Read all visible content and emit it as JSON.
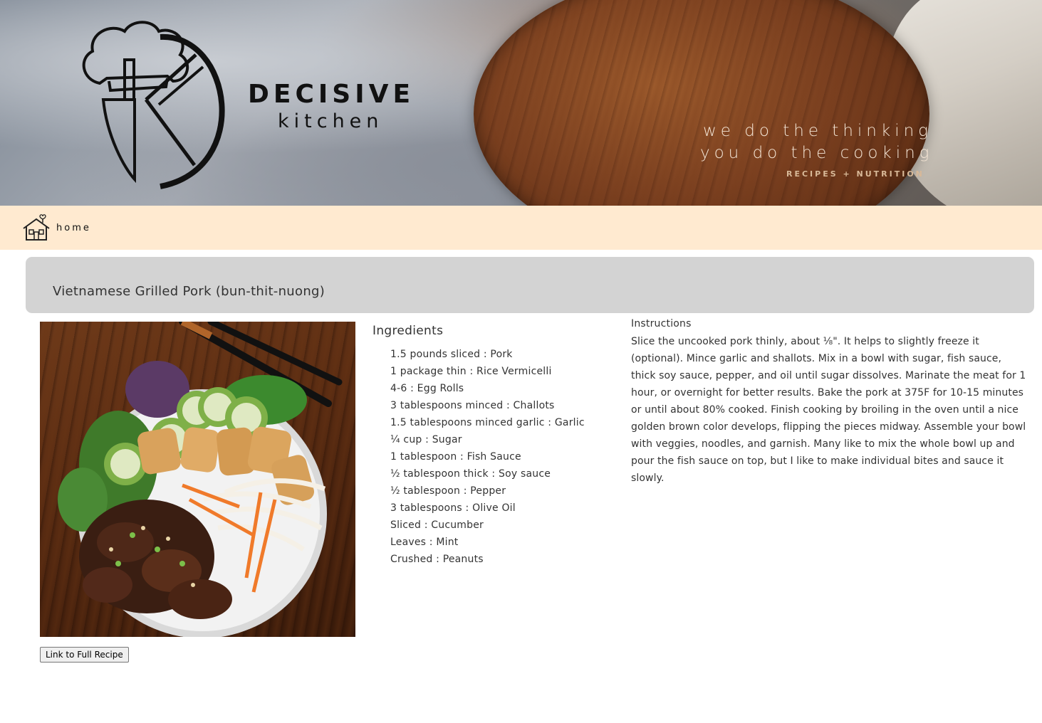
{
  "header": {
    "brand_line1": "DECISIVE",
    "brand_line2": "kitchen",
    "tagline_line1": "we do the thinking",
    "tagline_line2": "you do the cooking",
    "tagline_line3": "RECIPES + NUTRITION",
    "logo_icon": "chef-knife-plate-logo"
  },
  "nav": {
    "home_label": "home",
    "home_icon": "house-heart-icon"
  },
  "recipe": {
    "title": "Vietnamese Grilled Pork (bun-thit-nuong)",
    "image_subject": "bowl-of-vermicelli-grilled-pork-egg-rolls",
    "link_button_label": "Link to Full Recipe",
    "ingredients_heading": "Ingredients",
    "ingredients": [
      "1.5 pounds sliced : Pork",
      "1 package thin : Rice Vermicelli",
      "4-6 : Egg Rolls",
      "3 tablespoons minced : Challots",
      "1.5 tablespoons minced garlic : Garlic",
      "¼ cup : Sugar",
      "1 tablespoon : Fish Sauce",
      "½ tablespoon thick : Soy sauce",
      "½ tablespoon : Pepper",
      "3 tablespoons : Olive Oil",
      "Sliced : Cucumber",
      "Leaves : Mint",
      "Crushed : Peanuts"
    ],
    "instructions_heading": "Instructions",
    "instructions": "Slice the uncooked pork thinly, about ⅛\". It helps to slightly freeze it (optional). Mince garlic and shallots. Mix in a bowl with sugar, fish sauce, thick soy sauce, pepper, and oil until sugar dissolves. Marinate the meat for 1 hour, or overnight for better results. Bake the pork at 375F for 10-15 minutes or until about 80% cooked. Finish cooking by broiling in the oven until a nice golden brown color develops, flipping the pieces midway. Assemble your bowl with veggies, noodles, and garnish. Many like to mix the whole bowl up and pour the fish sauce on top, but I like to make individual bites and sauce it slowly."
  },
  "colors": {
    "nav_background": "#ffead0",
    "title_panel": "#d3d3d3",
    "text": "#333333"
  }
}
